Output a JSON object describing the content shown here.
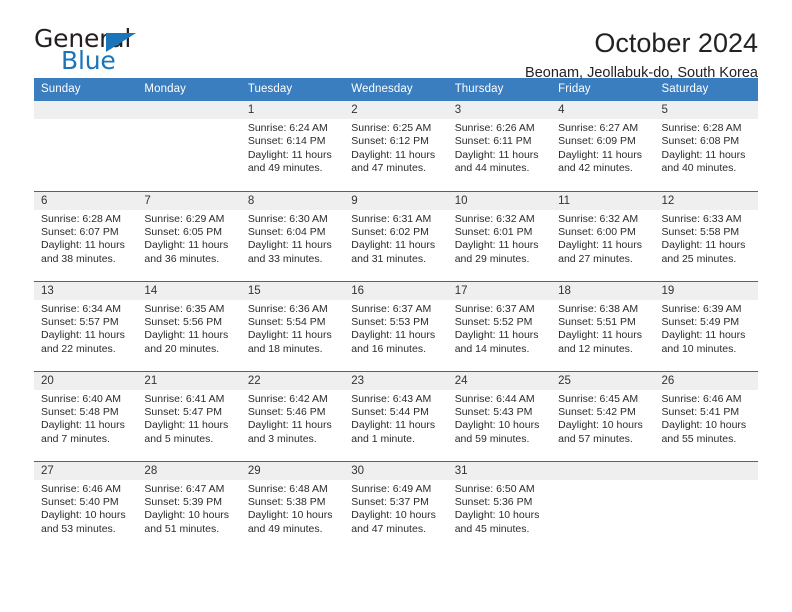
{
  "logo": {
    "line1": "General",
    "line2": "Blue",
    "triangle_icon": "triangle-icon",
    "color_dark": "#231f20",
    "color_blue": "#1b75bb"
  },
  "header": {
    "title": "October 2024",
    "subtitle": "Beonam, Jeollabuk-do, South Korea"
  },
  "theme": {
    "header_bg": "#3a7ebf",
    "row_divider": "#2e6da4",
    "daynum_bg": "#efefef",
    "text": "#2b2b2b"
  },
  "calendar": {
    "weekday_headers": [
      "Sunday",
      "Monday",
      "Tuesday",
      "Wednesday",
      "Thursday",
      "Friday",
      "Saturday"
    ],
    "labels": {
      "sunrise": "Sunrise:",
      "sunset": "Sunset:",
      "daylight": "Daylight:"
    },
    "weeks": [
      [
        {
          "day": "",
          "sunrise": "",
          "sunset": "",
          "daylight_line1": "",
          "daylight_line2": "",
          "empty": true
        },
        {
          "day": "",
          "sunrise": "",
          "sunset": "",
          "daylight_line1": "",
          "daylight_line2": "",
          "empty": true
        },
        {
          "day": "1",
          "sunrise": "Sunrise: 6:24 AM",
          "sunset": "Sunset: 6:14 PM",
          "daylight_line1": "Daylight: 11 hours",
          "daylight_line2": "and 49 minutes.",
          "empty": false
        },
        {
          "day": "2",
          "sunrise": "Sunrise: 6:25 AM",
          "sunset": "Sunset: 6:12 PM",
          "daylight_line1": "Daylight: 11 hours",
          "daylight_line2": "and 47 minutes.",
          "empty": false
        },
        {
          "day": "3",
          "sunrise": "Sunrise: 6:26 AM",
          "sunset": "Sunset: 6:11 PM",
          "daylight_line1": "Daylight: 11 hours",
          "daylight_line2": "and 44 minutes.",
          "empty": false
        },
        {
          "day": "4",
          "sunrise": "Sunrise: 6:27 AM",
          "sunset": "Sunset: 6:09 PM",
          "daylight_line1": "Daylight: 11 hours",
          "daylight_line2": "and 42 minutes.",
          "empty": false
        },
        {
          "day": "5",
          "sunrise": "Sunrise: 6:28 AM",
          "sunset": "Sunset: 6:08 PM",
          "daylight_line1": "Daylight: 11 hours",
          "daylight_line2": "and 40 minutes.",
          "empty": false
        }
      ],
      [
        {
          "day": "6",
          "sunrise": "Sunrise: 6:28 AM",
          "sunset": "Sunset: 6:07 PM",
          "daylight_line1": "Daylight: 11 hours",
          "daylight_line2": "and 38 minutes.",
          "empty": false
        },
        {
          "day": "7",
          "sunrise": "Sunrise: 6:29 AM",
          "sunset": "Sunset: 6:05 PM",
          "daylight_line1": "Daylight: 11 hours",
          "daylight_line2": "and 36 minutes.",
          "empty": false
        },
        {
          "day": "8",
          "sunrise": "Sunrise: 6:30 AM",
          "sunset": "Sunset: 6:04 PM",
          "daylight_line1": "Daylight: 11 hours",
          "daylight_line2": "and 33 minutes.",
          "empty": false
        },
        {
          "day": "9",
          "sunrise": "Sunrise: 6:31 AM",
          "sunset": "Sunset: 6:02 PM",
          "daylight_line1": "Daylight: 11 hours",
          "daylight_line2": "and 31 minutes.",
          "empty": false
        },
        {
          "day": "10",
          "sunrise": "Sunrise: 6:32 AM",
          "sunset": "Sunset: 6:01 PM",
          "daylight_line1": "Daylight: 11 hours",
          "daylight_line2": "and 29 minutes.",
          "empty": false
        },
        {
          "day": "11",
          "sunrise": "Sunrise: 6:32 AM",
          "sunset": "Sunset: 6:00 PM",
          "daylight_line1": "Daylight: 11 hours",
          "daylight_line2": "and 27 minutes.",
          "empty": false
        },
        {
          "day": "12",
          "sunrise": "Sunrise: 6:33 AM",
          "sunset": "Sunset: 5:58 PM",
          "daylight_line1": "Daylight: 11 hours",
          "daylight_line2": "and 25 minutes.",
          "empty": false
        }
      ],
      [
        {
          "day": "13",
          "sunrise": "Sunrise: 6:34 AM",
          "sunset": "Sunset: 5:57 PM",
          "daylight_line1": "Daylight: 11 hours",
          "daylight_line2": "and 22 minutes.",
          "empty": false
        },
        {
          "day": "14",
          "sunrise": "Sunrise: 6:35 AM",
          "sunset": "Sunset: 5:56 PM",
          "daylight_line1": "Daylight: 11 hours",
          "daylight_line2": "and 20 minutes.",
          "empty": false
        },
        {
          "day": "15",
          "sunrise": "Sunrise: 6:36 AM",
          "sunset": "Sunset: 5:54 PM",
          "daylight_line1": "Daylight: 11 hours",
          "daylight_line2": "and 18 minutes.",
          "empty": false
        },
        {
          "day": "16",
          "sunrise": "Sunrise: 6:37 AM",
          "sunset": "Sunset: 5:53 PM",
          "daylight_line1": "Daylight: 11 hours",
          "daylight_line2": "and 16 minutes.",
          "empty": false
        },
        {
          "day": "17",
          "sunrise": "Sunrise: 6:37 AM",
          "sunset": "Sunset: 5:52 PM",
          "daylight_line1": "Daylight: 11 hours",
          "daylight_line2": "and 14 minutes.",
          "empty": false
        },
        {
          "day": "18",
          "sunrise": "Sunrise: 6:38 AM",
          "sunset": "Sunset: 5:51 PM",
          "daylight_line1": "Daylight: 11 hours",
          "daylight_line2": "and 12 minutes.",
          "empty": false
        },
        {
          "day": "19",
          "sunrise": "Sunrise: 6:39 AM",
          "sunset": "Sunset: 5:49 PM",
          "daylight_line1": "Daylight: 11 hours",
          "daylight_line2": "and 10 minutes.",
          "empty": false
        }
      ],
      [
        {
          "day": "20",
          "sunrise": "Sunrise: 6:40 AM",
          "sunset": "Sunset: 5:48 PM",
          "daylight_line1": "Daylight: 11 hours",
          "daylight_line2": "and 7 minutes.",
          "empty": false
        },
        {
          "day": "21",
          "sunrise": "Sunrise: 6:41 AM",
          "sunset": "Sunset: 5:47 PM",
          "daylight_line1": "Daylight: 11 hours",
          "daylight_line2": "and 5 minutes.",
          "empty": false
        },
        {
          "day": "22",
          "sunrise": "Sunrise: 6:42 AM",
          "sunset": "Sunset: 5:46 PM",
          "daylight_line1": "Daylight: 11 hours",
          "daylight_line2": "and 3 minutes.",
          "empty": false
        },
        {
          "day": "23",
          "sunrise": "Sunrise: 6:43 AM",
          "sunset": "Sunset: 5:44 PM",
          "daylight_line1": "Daylight: 11 hours",
          "daylight_line2": "and 1 minute.",
          "empty": false
        },
        {
          "day": "24",
          "sunrise": "Sunrise: 6:44 AM",
          "sunset": "Sunset: 5:43 PM",
          "daylight_line1": "Daylight: 10 hours",
          "daylight_line2": "and 59 minutes.",
          "empty": false
        },
        {
          "day": "25",
          "sunrise": "Sunrise: 6:45 AM",
          "sunset": "Sunset: 5:42 PM",
          "daylight_line1": "Daylight: 10 hours",
          "daylight_line2": "and 57 minutes.",
          "empty": false
        },
        {
          "day": "26",
          "sunrise": "Sunrise: 6:46 AM",
          "sunset": "Sunset: 5:41 PM",
          "daylight_line1": "Daylight: 10 hours",
          "daylight_line2": "and 55 minutes.",
          "empty": false
        }
      ],
      [
        {
          "day": "27",
          "sunrise": "Sunrise: 6:46 AM",
          "sunset": "Sunset: 5:40 PM",
          "daylight_line1": "Daylight: 10 hours",
          "daylight_line2": "and 53 minutes.",
          "empty": false
        },
        {
          "day": "28",
          "sunrise": "Sunrise: 6:47 AM",
          "sunset": "Sunset: 5:39 PM",
          "daylight_line1": "Daylight: 10 hours",
          "daylight_line2": "and 51 minutes.",
          "empty": false
        },
        {
          "day": "29",
          "sunrise": "Sunrise: 6:48 AM",
          "sunset": "Sunset: 5:38 PM",
          "daylight_line1": "Daylight: 10 hours",
          "daylight_line2": "and 49 minutes.",
          "empty": false
        },
        {
          "day": "30",
          "sunrise": "Sunrise: 6:49 AM",
          "sunset": "Sunset: 5:37 PM",
          "daylight_line1": "Daylight: 10 hours",
          "daylight_line2": "and 47 minutes.",
          "empty": false
        },
        {
          "day": "31",
          "sunrise": "Sunrise: 6:50 AM",
          "sunset": "Sunset: 5:36 PM",
          "daylight_line1": "Daylight: 10 hours",
          "daylight_line2": "and 45 minutes.",
          "empty": false
        },
        {
          "day": "",
          "sunrise": "",
          "sunset": "",
          "daylight_line1": "",
          "daylight_line2": "",
          "empty": true
        },
        {
          "day": "",
          "sunrise": "",
          "sunset": "",
          "daylight_line1": "",
          "daylight_line2": "",
          "empty": true
        }
      ]
    ]
  }
}
